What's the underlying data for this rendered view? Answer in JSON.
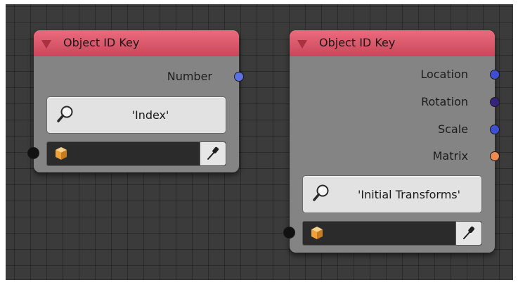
{
  "nodes": [
    {
      "title": "Object ID Key",
      "outputs": [
        {
          "label": "Number",
          "socket_color": "#5b72e0"
        }
      ],
      "key_value": "'Index'"
    },
    {
      "title": "Object ID Key",
      "outputs": [
        {
          "label": "Location",
          "socket_color": "#3f4fd1"
        },
        {
          "label": "Rotation",
          "socket_color": "#38237a"
        },
        {
          "label": "Scale",
          "socket_color": "#3f4fd1"
        },
        {
          "label": "Matrix",
          "socket_color": "#eb8a52"
        }
      ],
      "key_value": "'Initial Transforms'"
    }
  ],
  "colors": {
    "header": "#d9576a",
    "node_body": "#848484",
    "grid_background": "#3b3b3b",
    "cube_orange": "#f0a23a"
  },
  "icons": [
    "collapse-triangle-icon",
    "search-icon",
    "cube-icon",
    "eyedropper-icon"
  ]
}
